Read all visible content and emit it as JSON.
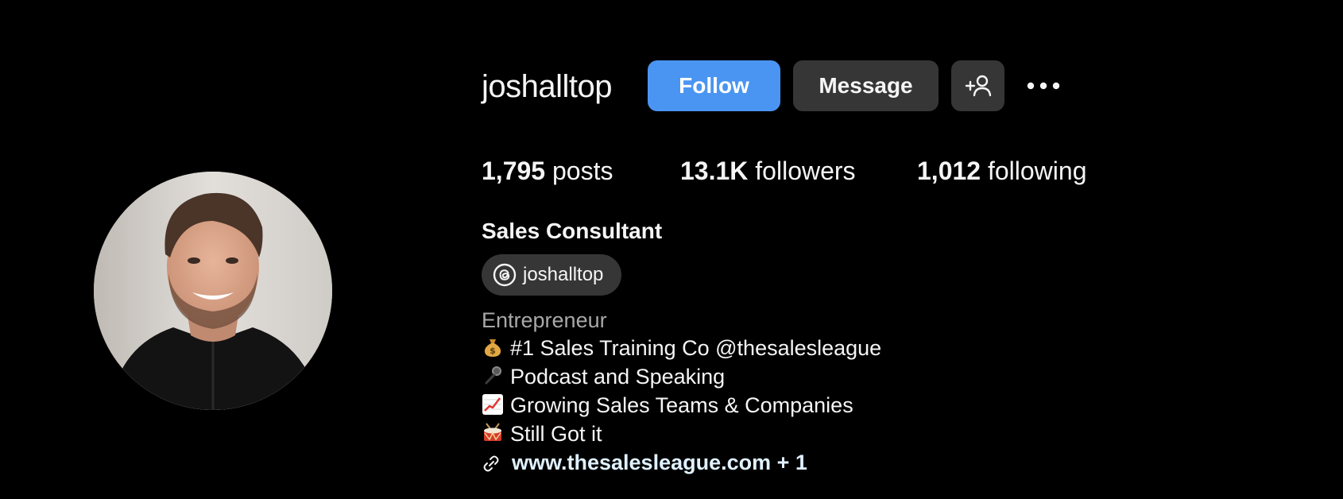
{
  "profile": {
    "username": "joshalltop",
    "full_name": "Sales Consultant",
    "category": "Entrepreneur",
    "avatar_icon": "profile-photo"
  },
  "actions": {
    "follow_label": "Follow",
    "message_label": "Message",
    "add_user_icon": "add-user-icon",
    "more_icon": "more-options-icon"
  },
  "stats": {
    "posts_count": "1,795",
    "posts_label": "posts",
    "followers_count": "13.1K",
    "followers_label": "followers",
    "following_count": "1,012",
    "following_label": "following"
  },
  "threads": {
    "icon": "threads-icon",
    "handle": "joshalltop"
  },
  "bio": [
    {
      "icon": "money-bag-emoji",
      "text": "#1 Sales Training Co @thesalesleague"
    },
    {
      "icon": "microphone-emoji",
      "text": "Podcast and Speaking"
    },
    {
      "icon": "chart-increasing-emoji",
      "text": "Growing Sales Teams & Companies"
    },
    {
      "icon": "drum-emoji",
      "text": "Still Got it"
    }
  ],
  "link": {
    "icon": "link-icon",
    "text": "www.thesalesleague.com + 1"
  },
  "colors": {
    "background": "#000000",
    "follow_button": "#4a95f2",
    "secondary_button": "#363636",
    "text": "#f5f5f5",
    "muted_text": "#a8a8a8",
    "link_text": "#e0f1ff"
  }
}
